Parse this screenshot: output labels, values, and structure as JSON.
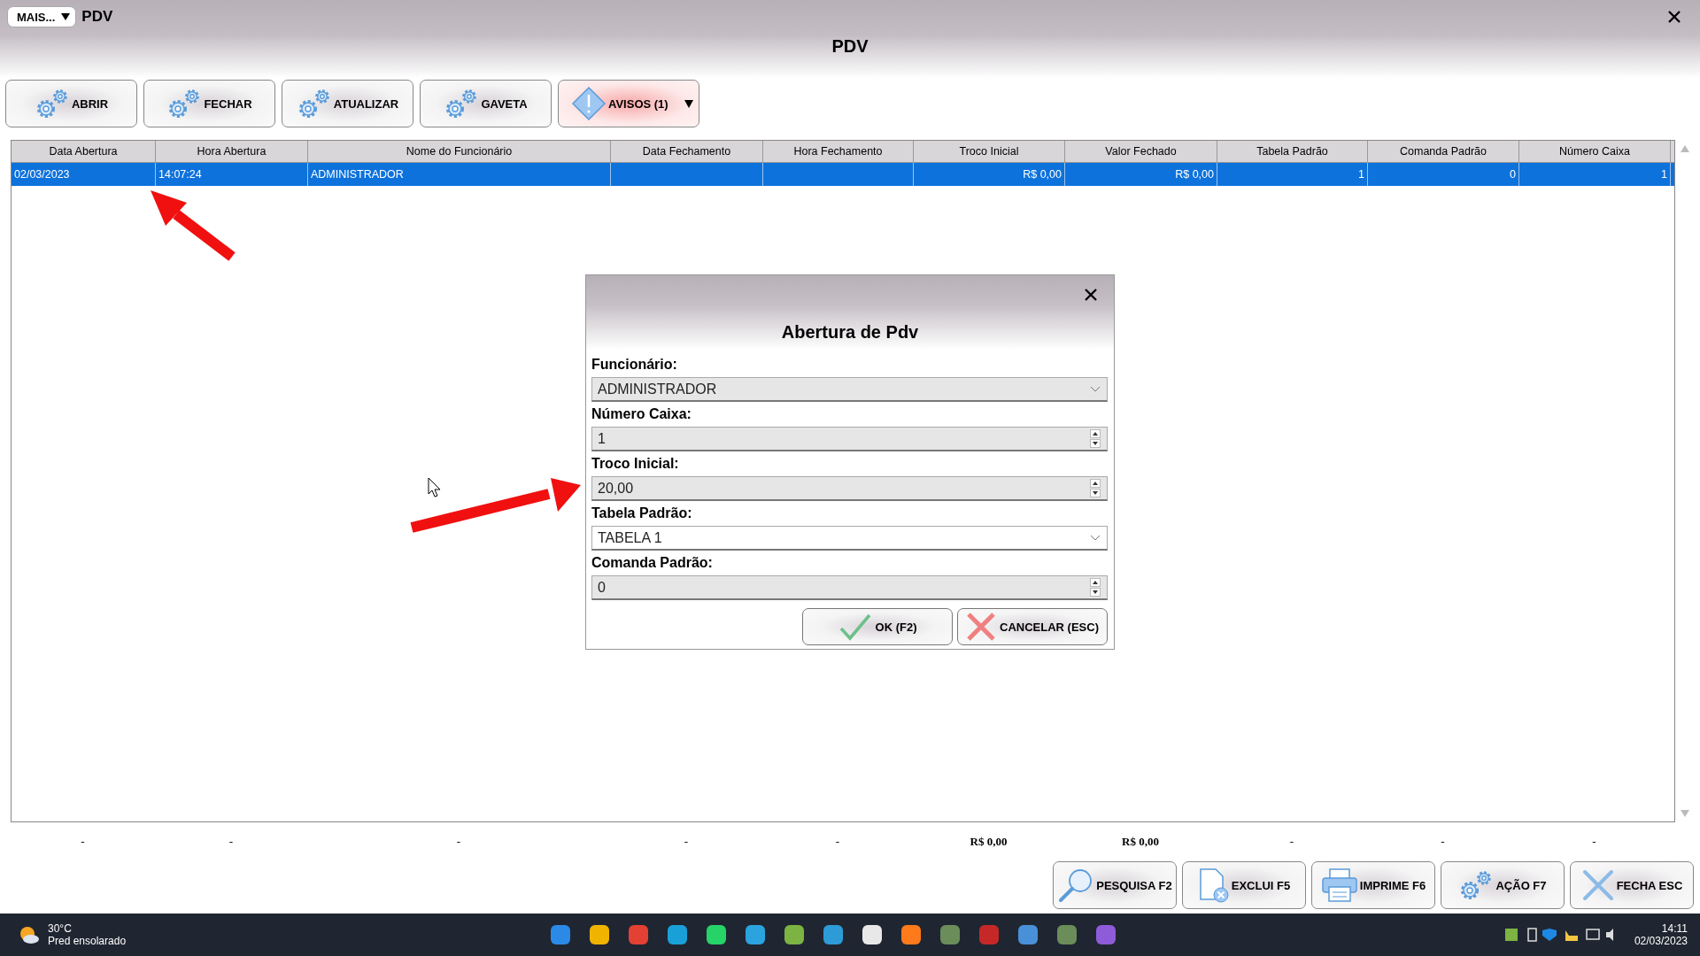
{
  "window": {
    "menu_button": "MAIS...",
    "title": "PDV",
    "heading": "PDV"
  },
  "toolbar": [
    {
      "label": "ABRIR",
      "kind": "gears"
    },
    {
      "label": "FECHAR",
      "kind": "gears"
    },
    {
      "label": "ATUALIZAR",
      "kind": "gears"
    },
    {
      "label": "GAVETA",
      "kind": "gears"
    },
    {
      "label": "AVISOS (1)",
      "kind": "alert"
    }
  ],
  "table": {
    "columns": [
      {
        "label": "Data Abertura"
      },
      {
        "label": "Hora Abertura"
      },
      {
        "label": "Nome do Funcionário"
      },
      {
        "label": "Data Fechamento"
      },
      {
        "label": "Hora Fechamento"
      },
      {
        "label": "Troco Inicial"
      },
      {
        "label": "Valor Fechado"
      },
      {
        "label": "Tabela Padrão"
      },
      {
        "label": "Comanda Padrão"
      },
      {
        "label": "Número Caixa"
      }
    ],
    "rows": [
      {
        "selected": true,
        "cells": [
          "02/03/2023",
          "14:07:24",
          "ADMINISTRADOR",
          "",
          "",
          "R$ 0,00",
          "R$ 0,00",
          "1",
          "0",
          "1"
        ]
      }
    ],
    "totals": [
      "-",
      "-",
      "-",
      "-",
      "-",
      "R$ 0,00",
      "R$ 0,00",
      "-",
      "-",
      "-"
    ]
  },
  "dialog": {
    "title": "Abertura de Pdv",
    "fields": [
      {
        "label": "Funcionário:",
        "kind": "select",
        "value": "ADMINISTRADOR",
        "disabled": true
      },
      {
        "label": "Número Caixa:",
        "kind": "spin",
        "value": "1",
        "disabled": true
      },
      {
        "label": "Troco Inicial:",
        "kind": "spin",
        "value": "20,00",
        "disabled": true
      },
      {
        "label": "Tabela Padrão:",
        "kind": "select",
        "value": "TABELA 1",
        "disabled": false
      },
      {
        "label": "Comanda Padrão:",
        "kind": "spin",
        "value": "0",
        "disabled": true
      }
    ],
    "buttons": [
      {
        "label": "OK (F2)",
        "kind": "ok"
      },
      {
        "label": "CANCELAR (ESC)",
        "kind": "cancel"
      }
    ]
  },
  "actions": [
    {
      "label": "PESQUISA F2",
      "kind": "search"
    },
    {
      "label": "EXCLUI F5",
      "kind": "delete"
    },
    {
      "label": "IMPRIME F6",
      "kind": "print"
    },
    {
      "label": "AÇÃO F7",
      "kind": "gears"
    },
    {
      "label": "FECHA ESC",
      "kind": "close"
    }
  ],
  "taskbar": {
    "weather": {
      "temperature": "30°C",
      "condition": "Pred ensolarado"
    },
    "time": "14:11",
    "date": "02/03/2023"
  }
}
